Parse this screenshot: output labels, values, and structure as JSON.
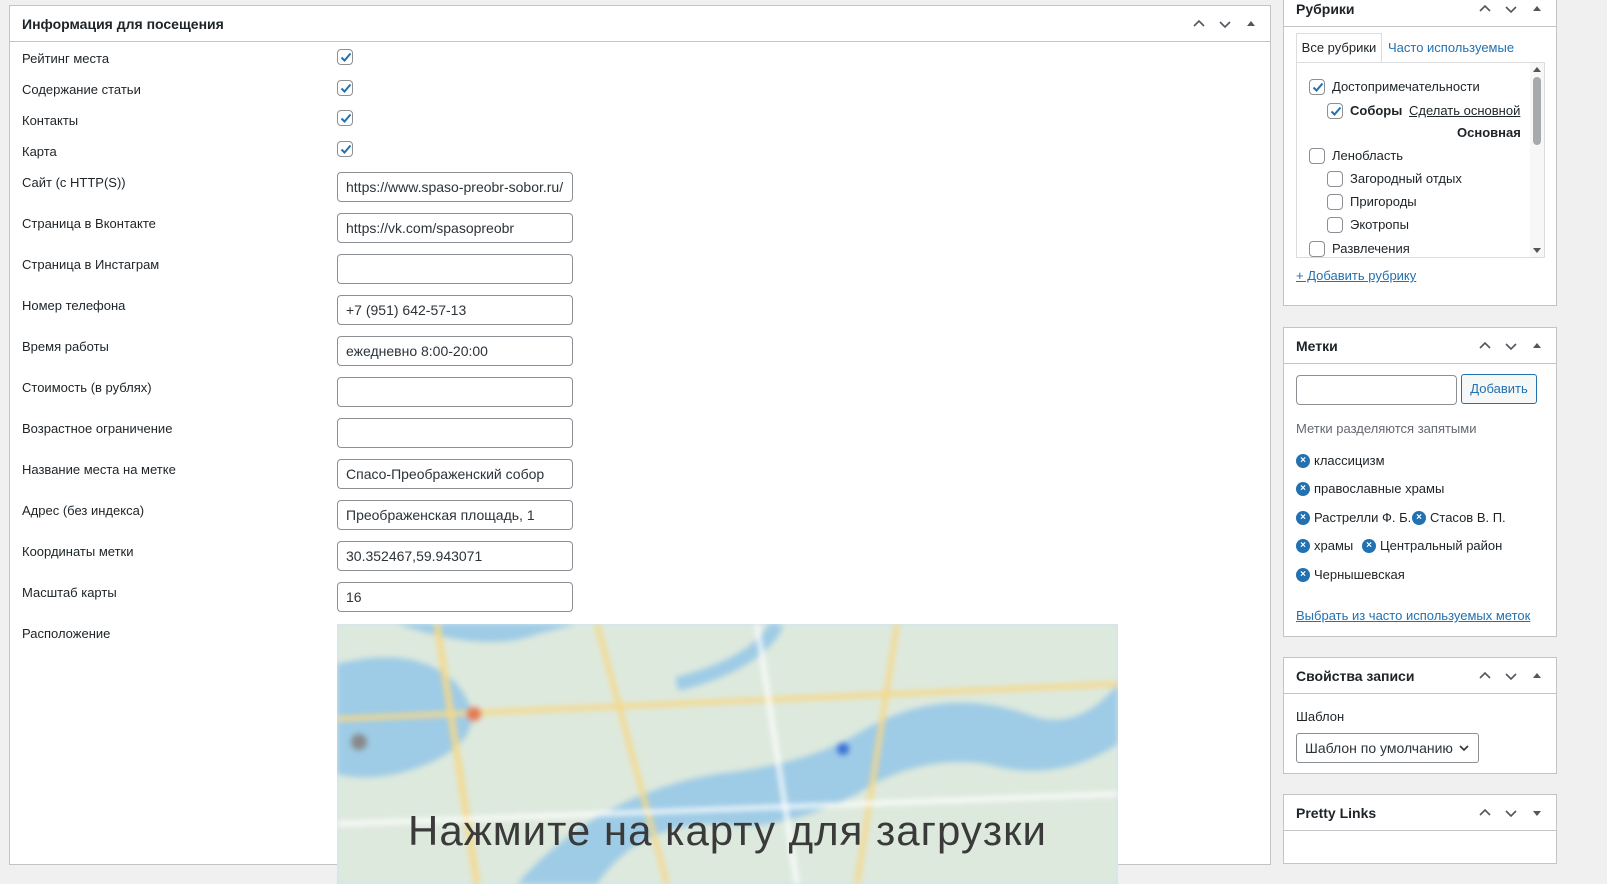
{
  "main_box": {
    "title": "Информация для посещения",
    "checkbox_fields": [
      {
        "label": "Рейтинг места",
        "checked": true
      },
      {
        "label": "Содержание статьи",
        "checked": true
      },
      {
        "label": "Контакты",
        "checked": true
      },
      {
        "label": "Карта",
        "checked": true
      }
    ],
    "text_fields": [
      {
        "label": "Сайт (с HTTP(S))",
        "value": "https://www.spaso-preobr-sobor.ru/"
      },
      {
        "label": "Страница в Вконтакте",
        "value": "https://vk.com/spasopreobr"
      },
      {
        "label": "Страница в Инстаграм",
        "value": ""
      },
      {
        "label": "Номер телефона",
        "value": "+7 (951) 642-57-13"
      },
      {
        "label": "Время работы",
        "value": "ежедневно 8:00-20:00"
      },
      {
        "label": "Стоимость (в рублях)",
        "value": ""
      },
      {
        "label": "Возрастное ограничение",
        "value": ""
      },
      {
        "label": "Название места на метке",
        "value": "Спасо-Преображенский собор"
      },
      {
        "label": "Адрес (без индекса)",
        "value": "Преображенская площадь, 1"
      },
      {
        "label": "Координаты метки",
        "value": "30.352467,59.943071"
      },
      {
        "label": "Масштаб карты",
        "value": "16"
      }
    ],
    "location_label": "Расположение",
    "map_caption": "Нажмите на карту для загрузки"
  },
  "categories_box": {
    "title": "Рубрики",
    "tab_all": "Все рубрики",
    "tab_popular": "Часто используемые",
    "items": [
      {
        "label": "Достопримечательности",
        "checked": true,
        "level": 0
      },
      {
        "label": "Соборы",
        "checked": true,
        "level": 1
      },
      {
        "label": "Ленобласть",
        "checked": false,
        "level": 0
      },
      {
        "label": "Загородный отдых",
        "checked": false,
        "level": 1
      },
      {
        "label": "Пригороды",
        "checked": false,
        "level": 1
      },
      {
        "label": "Экотропы",
        "checked": false,
        "level": 1
      },
      {
        "label": "Развлечения",
        "checked": false,
        "level": 0
      }
    ],
    "make_primary": "Сделать основной",
    "primary_label": "Основная",
    "add_link": "+ Добавить рубрику"
  },
  "tags_box": {
    "title": "Метки",
    "input_value": "",
    "add_button": "Добавить",
    "hint": "Метки разделяются запятыми",
    "tags": [
      "классицизм",
      "православные храмы",
      "Растрелли Ф. Б.",
      "Стасов В. П.",
      "храмы",
      "Центральный район",
      "Чернышевская"
    ],
    "choose_link": "Выбрать из часто используемых меток"
  },
  "attributes_box": {
    "title": "Свойства записи",
    "template_label": "Шаблон",
    "template_value": "Шаблон по умолчанию"
  },
  "pretty_links_box": {
    "title": "Pretty Links"
  },
  "colors": {
    "accent": "#2271b1",
    "border": "#c3c4c7",
    "background": "#f0f0f1"
  }
}
